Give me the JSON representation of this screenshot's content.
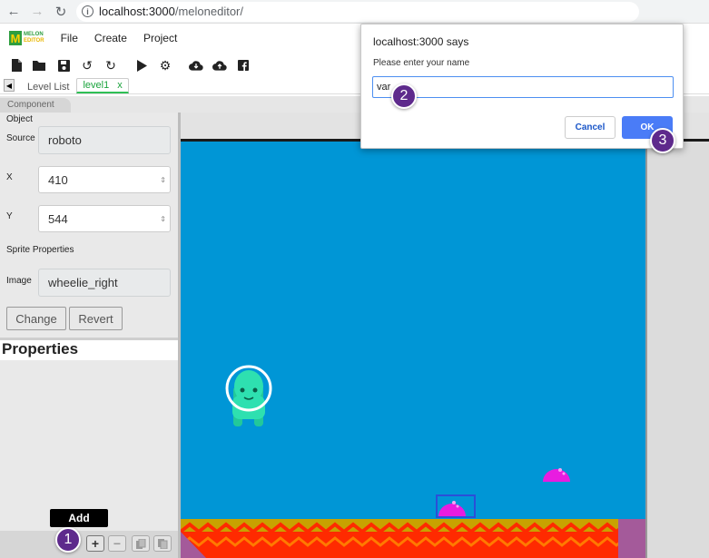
{
  "browser": {
    "url_host": "localhost:3000",
    "url_path": "/meloneditor/"
  },
  "app": {
    "logo_line1": "MELON",
    "logo_line2": "EDITOR",
    "menu": [
      "File",
      "Create",
      "Project"
    ]
  },
  "tabs": {
    "level_list": "Level List",
    "active_tab": "level1",
    "close": "x",
    "component": "Component"
  },
  "object": {
    "section": "Object",
    "source_label": "Source",
    "source_value": "roboto",
    "x_label": "X",
    "x_value": "410",
    "y_label": "Y",
    "y_value": "544",
    "sprite_props": "Sprite Properties",
    "image_label": "Image",
    "image_value": "wheelie_right",
    "change_btn": "Change",
    "revert_btn": "Revert"
  },
  "properties": {
    "title": "Properties",
    "add_tooltip": "Add"
  },
  "dialog": {
    "title": "localhost:3000 says",
    "message": "Please enter your name",
    "input_value": "var",
    "cancel": "Cancel",
    "ok": "OK"
  },
  "badges": [
    "1",
    "2",
    "3"
  ],
  "colors": {
    "game_bg": "#0096d6",
    "accent_green": "#2fbf55",
    "badge": "#5e2a8c",
    "ok_button": "#4a7cf7",
    "lava": "#ff2a00",
    "enemy": "#e81ce0"
  }
}
